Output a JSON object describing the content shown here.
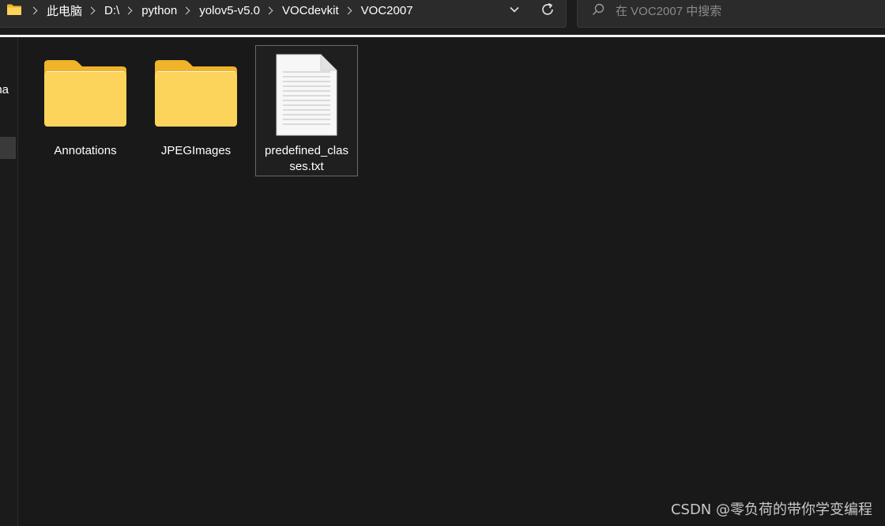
{
  "address_bar": {
    "breadcrumbs": [
      "此电脑",
      "D:\\",
      "python",
      "yolov5-v5.0",
      "VOCdevkit",
      "VOC2007"
    ]
  },
  "search": {
    "placeholder": "在 VOC2007 中搜索"
  },
  "nav_pane": {
    "partial_item_text": "ona"
  },
  "files": [
    {
      "name": "Annotations",
      "type": "folder",
      "icon": "folder-icon"
    },
    {
      "name": "JPEGImages",
      "type": "folder",
      "icon": "folder-icon"
    },
    {
      "name_line1": "predefined_clas",
      "name_line2": "ses.txt",
      "type": "text-file",
      "icon": "text-file-icon"
    }
  ],
  "watermark": "CSDN @零负荷的带你学变编程",
  "colors": {
    "background": "#191919",
    "folder_yellow": "#fcd35b",
    "folder_tab": "#f0b429",
    "selection_border": "#6a6a6a"
  }
}
